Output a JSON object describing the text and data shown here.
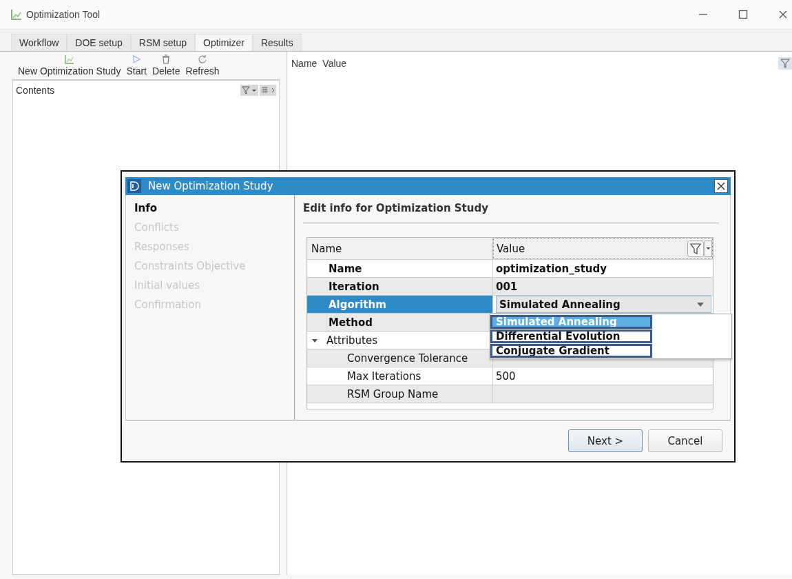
{
  "window": {
    "title": "Optimization Tool"
  },
  "tabs": [
    {
      "label": "Workflow",
      "selected": false
    },
    {
      "label": "DOE setup",
      "selected": false
    },
    {
      "label": "RSM setup",
      "selected": false
    },
    {
      "label": "Optimizer",
      "selected": true
    },
    {
      "label": "Results",
      "selected": false
    }
  ],
  "toolbar": [
    {
      "label": "New Optimization Study",
      "kind": "new"
    },
    {
      "label": "Start",
      "kind": "start"
    },
    {
      "label": "Delete",
      "kind": "delete"
    },
    {
      "label": "Refresh",
      "kind": "refresh"
    }
  ],
  "contents_panel": {
    "title": "Contents"
  },
  "details_panel": {
    "columns": [
      "Name",
      "Value"
    ]
  },
  "dialog": {
    "title": "New Optimization Study",
    "steps": [
      {
        "label": "Info",
        "selected": true,
        "disabled": false
      },
      {
        "label": "Conflicts",
        "selected": false,
        "disabled": true
      },
      {
        "label": "Responses",
        "selected": false,
        "disabled": true
      },
      {
        "label": "Constraints Objective",
        "selected": false,
        "disabled": true
      },
      {
        "label": "Initial values",
        "selected": false,
        "disabled": true
      },
      {
        "label": "Confirmation",
        "selected": false,
        "disabled": true
      }
    ],
    "heading": "Edit info for Optimization Study",
    "columns": [
      "Name",
      "Value"
    ],
    "rows": [
      {
        "name": "Name",
        "value": "optimization_study",
        "kind": "field",
        "selected": false
      },
      {
        "name": "Iteration",
        "value": "001",
        "kind": "field",
        "selected": false
      },
      {
        "name": "Algorithm",
        "value": "Simulated Annealing",
        "kind": "combo",
        "selected": true
      },
      {
        "name": "Method",
        "kind": "field",
        "selected": false
      },
      {
        "name": "Attributes",
        "kind": "group",
        "selected": false,
        "expanded": true,
        "children": [
          {
            "name": "Convergence Tolerance",
            "kind": "child",
            "selected": false
          },
          {
            "name": "Max Iterations",
            "value": "500",
            "kind": "child",
            "selected": false
          },
          {
            "name": "RSM Group Name",
            "kind": "child",
            "selected": false
          }
        ]
      }
    ],
    "dropdown": [
      {
        "label": "Simulated Annealing",
        "selected": true
      },
      {
        "label": "Differential Evolution",
        "selected": false
      },
      {
        "label": "Conjugate Gradient",
        "selected": false
      }
    ],
    "buttons": [
      {
        "label": "Next >",
        "default": true
      },
      {
        "label": "Cancel",
        "default": false
      }
    ]
  }
}
